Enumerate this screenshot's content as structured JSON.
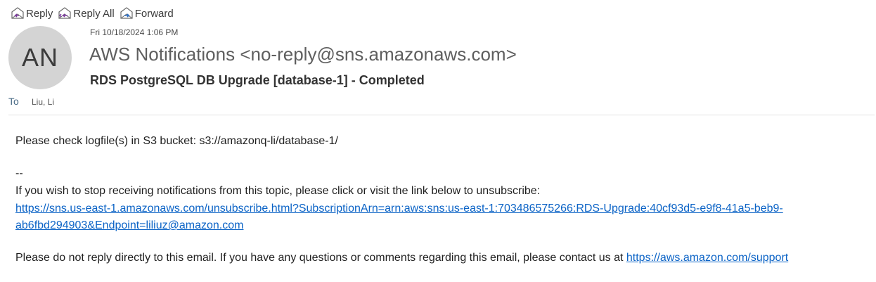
{
  "toolbar": {
    "reply_label": "Reply",
    "reply_all_label": "Reply All",
    "forward_label": "Forward",
    "icons": {
      "reply": "reply-icon",
      "reply_all": "reply-all-icon",
      "forward": "forward-icon"
    },
    "icon_colors": {
      "reply": "#7a3b9c",
      "forward": "#2f6fc2"
    }
  },
  "header": {
    "avatar_initials": "AN",
    "date": "Fri 10/18/2024 1:06 PM",
    "sender": "AWS Notifications <no-reply@sns.amazonaws.com>",
    "subject": "RDS PostgreSQL DB Upgrade [database-1] - Completed",
    "to_label": "To",
    "to_value": "Liu, Li"
  },
  "body": {
    "line1": "Please check logfile(s) in S3 bucket:   s3://amazonq-li/database-1/",
    "separator": "--",
    "line2": "If you wish to stop receiving notifications from this topic, please click or visit the link below to unsubscribe:",
    "unsubscribe_link_part1": "https://sns.us-east-1.amazonaws.com/unsubscribe.html?SubscriptionArn=arn:aws:sns:us-east-1:703486575266:RDS-Upgrade:40cf93d5-e9f8-41a5-beb9-",
    "unsubscribe_link_part2": "ab6fbd294903&Endpoint=liliuz@amazon.com",
    "line3_prefix": "Please do not reply directly to this email. If you have any questions or comments regarding this email, please contact us at ",
    "support_link": "https://aws.amazon.com/support"
  },
  "colors": {
    "link": "#0b63c6",
    "avatar_bg": "#d4d4d4"
  }
}
